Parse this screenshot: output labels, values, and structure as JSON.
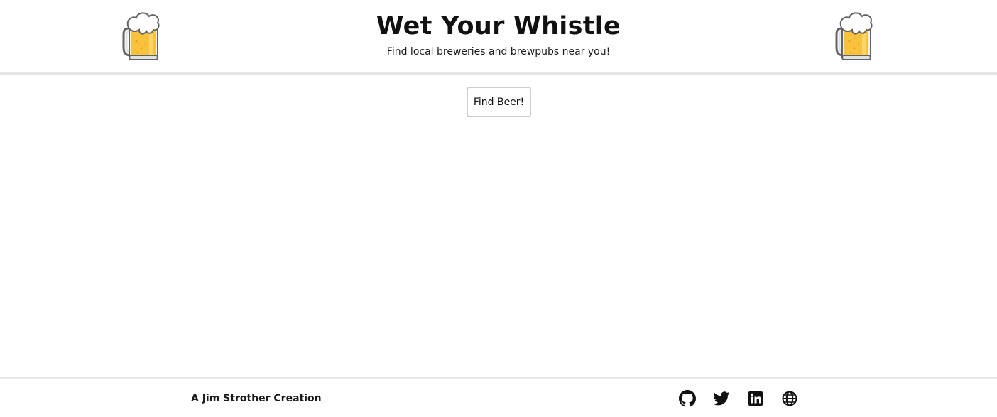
{
  "header": {
    "title": "Wet Your Whistle",
    "subtitle": "Find local breweries and brewpubs near you!",
    "left_icon": "beer-mug-icon",
    "right_icon": "beer-mug-icon"
  },
  "main": {
    "find_button_label": "Find Beer!"
  },
  "footer": {
    "credit": "A Jim Strother Creation",
    "links": [
      {
        "icon": "github-icon"
      },
      {
        "icon": "twitter-icon"
      },
      {
        "icon": "linkedin-icon"
      },
      {
        "icon": "globe-icon"
      }
    ]
  },
  "colors": {
    "beer": "#f9c23c",
    "foam": "#ffffff",
    "glass_outline": "#636363",
    "divider": "#e6e6e6",
    "button_border": "#cfcfcf"
  }
}
